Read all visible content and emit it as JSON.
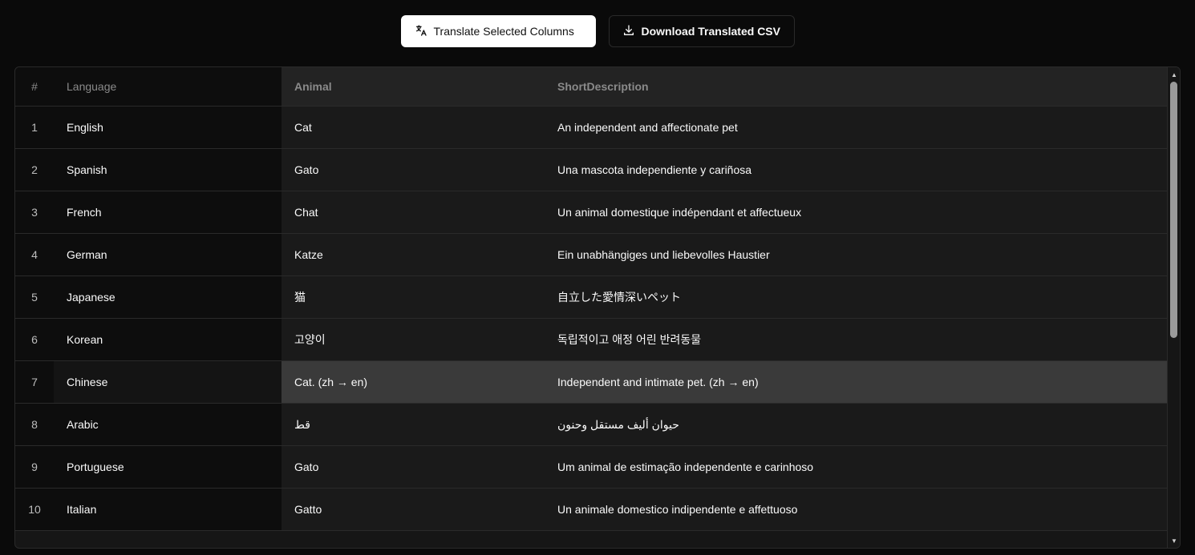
{
  "toolbar": {
    "translate_label": "Translate Selected Columns",
    "download_label": "Download Translated CSV",
    "translate_icon": "translate-icon",
    "download_icon": "download-icon"
  },
  "table": {
    "headers": {
      "num": "#",
      "language": "Language",
      "animal": "Animal",
      "description": "ShortDescription"
    },
    "rows": [
      {
        "num": "1",
        "language": "English",
        "animal": "Cat",
        "description": "An independent and affectionate pet"
      },
      {
        "num": "2",
        "language": "Spanish",
        "animal": "Gato",
        "description": "Una mascota independiente y cariñosa"
      },
      {
        "num": "3",
        "language": "French",
        "animal": "Chat",
        "description": "Un animal domestique indépendant et affectueux"
      },
      {
        "num": "4",
        "language": "German",
        "animal": "Katze",
        "description": "Ein unabhängiges und liebevolles Haustier"
      },
      {
        "num": "5",
        "language": "Japanese",
        "animal": "猫",
        "description": "自立した愛情深いペット"
      },
      {
        "num": "6",
        "language": "Korean",
        "animal": "고양이",
        "description": "독립적이고 애정 어린 반려동물"
      },
      {
        "num": "7",
        "language": "Chinese",
        "animal": "Cat. (zh → en)",
        "description": "Independent and intimate pet. (zh → en)"
      },
      {
        "num": "8",
        "language": "Arabic",
        "animal": "قط",
        "description": "حيوان أليف مستقل وحنون"
      },
      {
        "num": "9",
        "language": "Portuguese",
        "animal": "Gato",
        "description": "Um animal de estimação independente e carinhoso"
      },
      {
        "num": "10",
        "language": "Italian",
        "animal": "Gatto",
        "description": "Un animale domestico indipendente e affettuoso"
      }
    ],
    "selected_row": "7"
  }
}
